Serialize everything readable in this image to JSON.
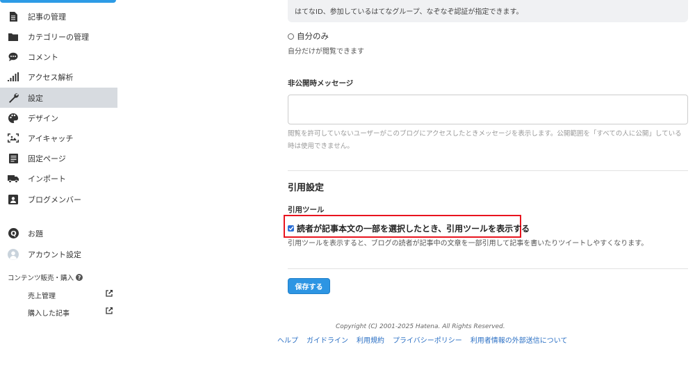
{
  "sidebar": {
    "items": [
      {
        "label": "記事の管理",
        "icon": "document-icon"
      },
      {
        "label": "カテゴリーの管理",
        "icon": "folder-icon"
      },
      {
        "label": "コメント",
        "icon": "comment-icon"
      },
      {
        "label": "アクセス解析",
        "icon": "bar-chart-icon"
      },
      {
        "label": "設定",
        "icon": "wrench-icon",
        "active": true
      },
      {
        "label": "デザイン",
        "icon": "palette-icon"
      },
      {
        "label": "アイキャッチ",
        "icon": "image-icon"
      },
      {
        "label": "固定ページ",
        "icon": "page-icon"
      },
      {
        "label": "インポート",
        "icon": "truck-icon"
      },
      {
        "label": "ブログメンバー",
        "icon": "members-icon"
      },
      {
        "label": "お題",
        "icon": "q-icon"
      },
      {
        "label": "アカウント設定",
        "icon": "avatar-icon"
      }
    ],
    "content_sales_label": "コンテンツ販売・購入",
    "sub_items": [
      {
        "label": "売上管理"
      },
      {
        "label": "購入した記事"
      }
    ]
  },
  "main": {
    "info_text": "はてなID、参加しているはてなグループ、なぞなぞ認証が指定できます。",
    "radio_private_label": "自分のみ",
    "radio_private_desc": "自分だけが閲覧できます",
    "private_message_label": "非公開時メッセージ",
    "private_message_value": "",
    "private_message_hint": "閲覧を許可していないユーザーがこのブログにアクセスしたときメッセージを表示します。公開範囲を「すべての人に公開」している時は使用できません。",
    "quote_section_title": "引用設定",
    "quote_tool_label": "引用ツール",
    "quote_tool_checkbox_label": "読者が記事本文の一部を選択したとき、引用ツールを表示する",
    "quote_tool_checked": true,
    "quote_tool_desc": "引用ツールを表示すると、ブログの読者が記事中の文章を一部引用して記事を書いたりツイートしやすくなります。",
    "save_label": "保存する"
  },
  "footer": {
    "copyright": "Copyright (C) 2001-2025 Hatena. All Rights Reserved.",
    "links": [
      "ヘルプ",
      "ガイドライン",
      "利用規約",
      "プライバシーポリシー",
      "利用者情報の外部送信について"
    ]
  },
  "colors": {
    "accent": "#2d95e3",
    "highlight_border": "#e8141e",
    "active_nav_bg": "#d7dbe0",
    "link": "#2a6fc4"
  }
}
